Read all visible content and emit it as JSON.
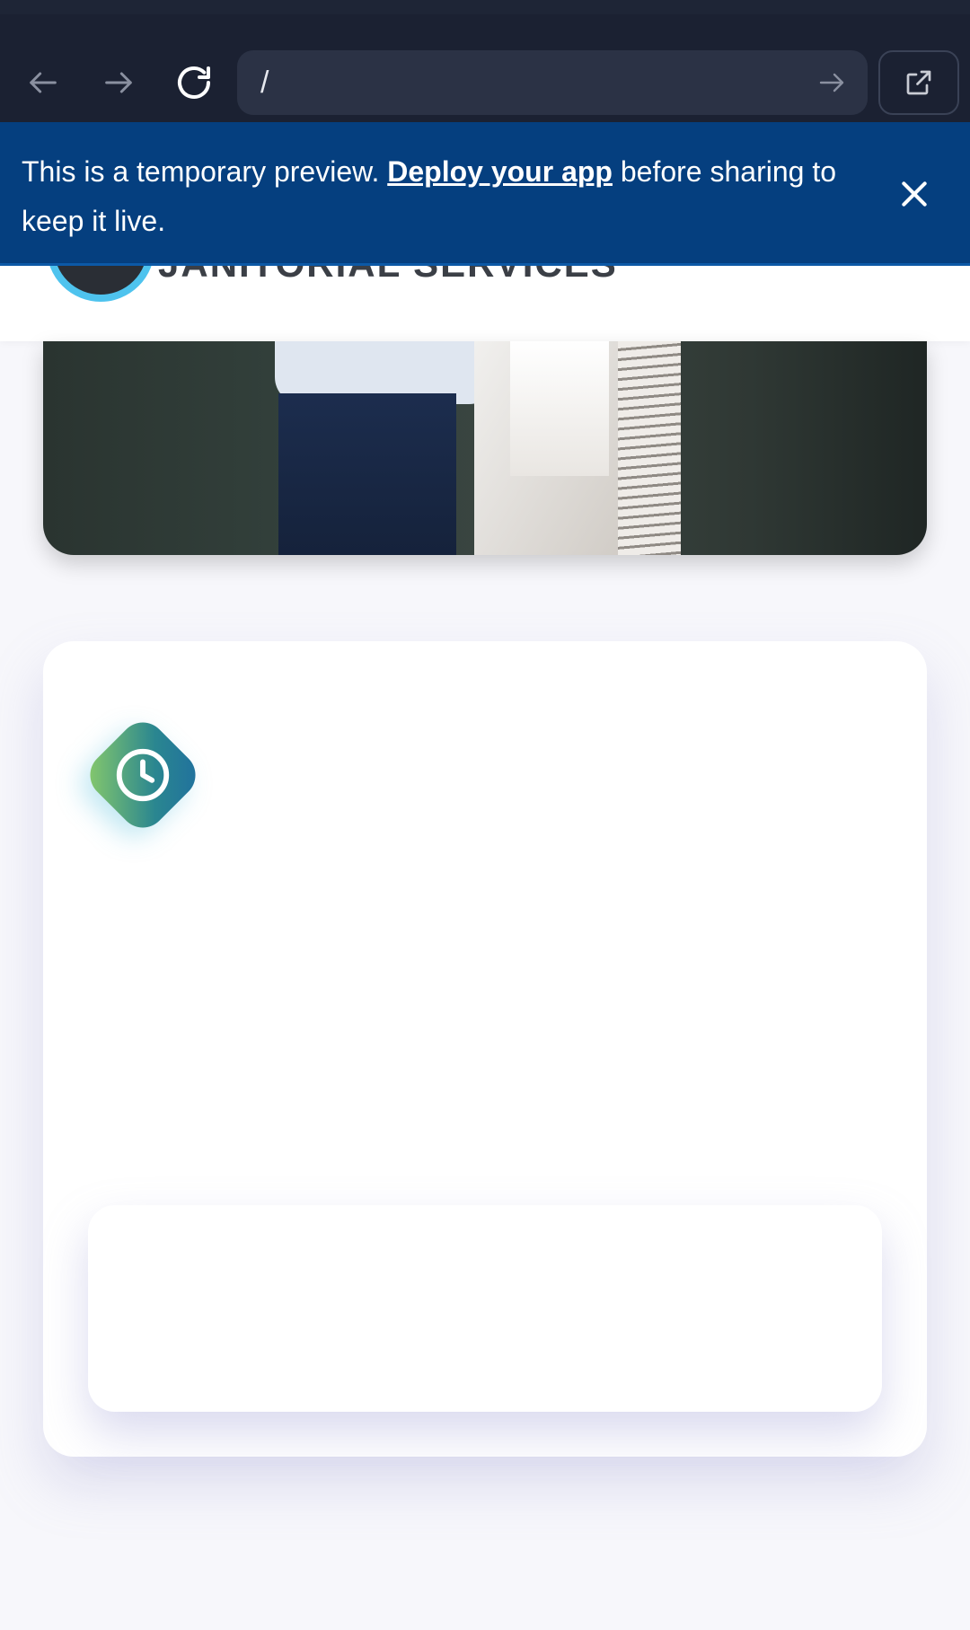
{
  "browser": {
    "url": "/",
    "icons": [
      "back-arrow-icon",
      "forward-arrow-icon",
      "reload-icon",
      "go-arrow-icon",
      "open-external-icon"
    ]
  },
  "banner": {
    "text_before": "This is a temporary preview. ",
    "link_text": "Deploy your app",
    "text_after": " before sharing to keep it live.",
    "background": "#053f7f"
  },
  "site": {
    "logo_text": "JANITORIAL SERVICES"
  },
  "feature_card": {
    "icon": "clock-icon",
    "icon_gradient": [
      "#8fcf68",
      "#1f6ea0"
    ]
  }
}
